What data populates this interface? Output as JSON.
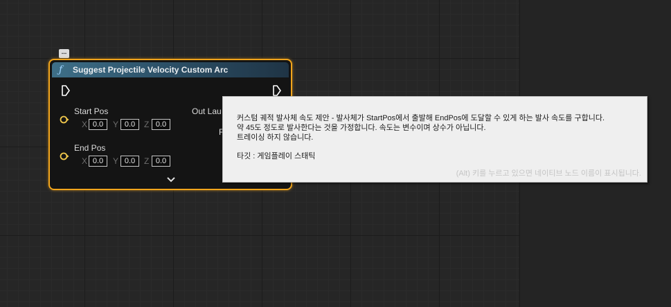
{
  "node": {
    "title": "Suggest Projectile Velocity Custom Arc",
    "comment_icon": "...",
    "inputs": [
      {
        "label": "Start Pos",
        "x_label": "X",
        "x": "0.0",
        "y_label": "Y",
        "y": "0.0",
        "z_label": "Z",
        "z": "0.0"
      },
      {
        "label": "End Pos",
        "x_label": "X",
        "x": "0.0",
        "y_label": "Y",
        "y": "0.0",
        "z_label": "Z",
        "z": "0.0"
      }
    ],
    "outputs": [
      {
        "label": "Out Lau"
      },
      {
        "label": "R"
      }
    ]
  },
  "tooltip": {
    "line1": "커스텀 궤적 발사체 속도 제안 - 발사체가 StartPos에서 출발해 EndPos에 도달할 수 있게 하는 발사 속도를 구합니다.",
    "line2": "약 45도 정도로 발사한다는 것을 가정합니다. 속도는 변수이며 상수가 아닙니다.",
    "line3": "트레이싱 하지 않습니다.",
    "target": "타깃 : 게임플레이 스태틱",
    "hint": "(Alt) 키를 누르고 있으면 네이티브 노드 이름이 표시됩니다."
  },
  "colors": {
    "node_border": "#f2a51c",
    "header_start": "#3e6f88",
    "vector_pin": "#f2c94c",
    "tooltip_bg": "#efefef"
  },
  "icons": {
    "function": "function-icon",
    "exec_in": "exec-in-pin-icon",
    "exec_out": "exec-out-pin-icon",
    "expand": "chevron-down-icon"
  }
}
